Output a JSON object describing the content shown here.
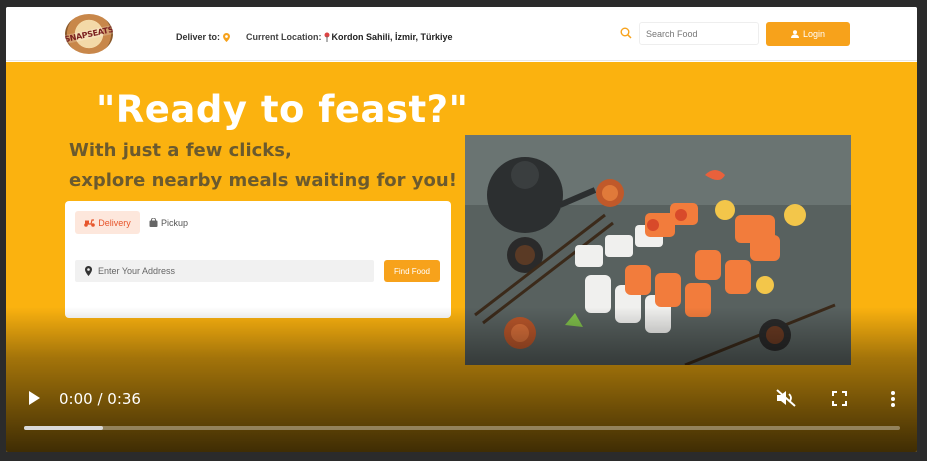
{
  "header": {
    "logo_text": "SNAPSEATS",
    "deliver_label": "Deliver to:",
    "current_location_label": "Current Location:",
    "current_location_value": "Kordon Sahili, İzmir, Türkiye",
    "search_placeholder": "Search Food",
    "login_label": "Login"
  },
  "hero": {
    "title": "\"Ready to feast?\"",
    "subtitle_line1": "With just a few clicks,",
    "subtitle_line2": "explore nearby meals waiting for you!"
  },
  "order_card": {
    "tabs": [
      {
        "label": "Delivery",
        "active": true
      },
      {
        "label": "Pickup",
        "active": false
      }
    ],
    "address_placeholder": "Enter Your Address",
    "find_button_label": "Find Food"
  },
  "video": {
    "time": "0:00 / 0:36",
    "progress_fraction": 0.09,
    "muted": true
  },
  "colors": {
    "accent": "#F7A21B",
    "hero_bg": "#FBB20F",
    "delivery_tab_bg": "#FDE7DC",
    "delivery_tab_text": "#E7552B"
  },
  "icons": [
    "map-pin-icon",
    "search-icon",
    "user-icon",
    "scooter-icon",
    "bag-icon",
    "play-icon",
    "mute-icon",
    "fullscreen-icon",
    "more-vert-icon"
  ]
}
